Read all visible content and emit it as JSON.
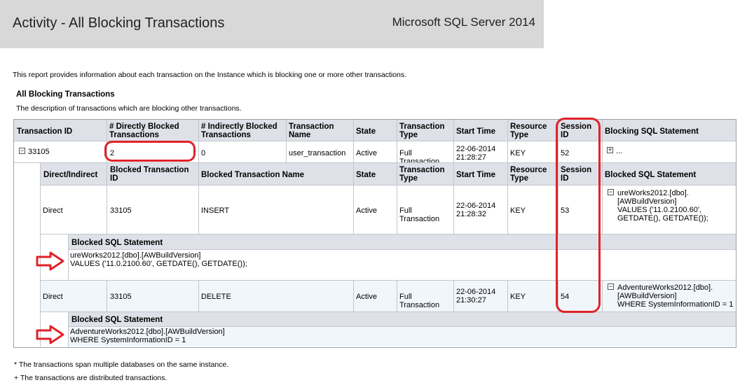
{
  "header": {
    "title": "Activity - All Blocking Transactions",
    "product": "Microsoft SQL Server 2014"
  },
  "report_description": "This report provides information about each transaction on the Instance which is blocking one or more other transactions.",
  "section": {
    "title": "All Blocking Transactions",
    "description": "The description of transactions which are blocking other transactions."
  },
  "main_table": {
    "columns": [
      "Transaction ID",
      "# Directly Blocked Transactions",
      "# Indirectly Blocked Transactions",
      "Transaction Name",
      "State",
      "Transaction Type",
      "Start Time",
      "Resource Type",
      "Session ID",
      "Blocking SQL Statement"
    ],
    "row": {
      "toggle": "−",
      "transaction_id": "33105",
      "directly_blocked": "2",
      "indirectly_blocked": "0",
      "transaction_name": "user_transaction",
      "state": "Active",
      "transaction_type": "Full Transaction",
      "start_time": "22-06-2014 21:28:27",
      "resource_type": "KEY",
      "session_id": "52",
      "blocking_sql_toggle": "+",
      "blocking_sql": "..."
    }
  },
  "sub_table": {
    "columns": [
      "Direct/Indirect",
      "Blocked Transaction ID",
      "Blocked Transaction Name",
      "State",
      "Transaction Type",
      "Start Time",
      "Resource Type",
      "Session ID",
      "Blocked SQL Statement"
    ],
    "rows": [
      {
        "direct_indirect": "Direct",
        "blocked_transaction_id": "33105",
        "blocked_transaction_name": "INSERT",
        "state": "Active",
        "transaction_type": "Full Transaction",
        "start_time": "22-06-2014 21:28:32",
        "resource_type": "KEY",
        "session_id": "53",
        "sql_toggle": "−",
        "blocked_sql": "ureWorks2012.[dbo].\n[AWBuildVersion]\nVALUES ('11.0.2100.60',\nGETDATE(), GETDATE());",
        "detail_header": "Blocked SQL Statement",
        "detail_sql": "ureWorks2012.[dbo].[AWBuildVersion]\nVALUES ('11.0.2100.60', GETDATE(), GETDATE());"
      },
      {
        "direct_indirect": "Direct",
        "blocked_transaction_id": "33105",
        "blocked_transaction_name": "DELETE",
        "state": "Active",
        "transaction_type": "Full Transaction",
        "start_time": "22-06-2014 21:30:27",
        "resource_type": "KEY",
        "session_id": "54",
        "sql_toggle": "−",
        "blocked_sql": "AdventureWorks2012.[dbo].\n[AWBuildVersion]\nWHERE SystemInformationID = 1",
        "detail_header": "Blocked SQL Statement",
        "detail_sql": "AdventureWorks2012.[dbo].[AWBuildVersion]\nWHERE SystemInformationID = 1"
      }
    ]
  },
  "footnotes": [
    "* The transactions span multiple databases on the same instance.",
    "+ The transactions are distributed transactions."
  ],
  "colors": {
    "header_bg": "#d8d8d8",
    "column_header_bg": "#dfe1e8",
    "highlight_row_bg": "#f1f6fb",
    "annotation_red": "#e0222a"
  }
}
